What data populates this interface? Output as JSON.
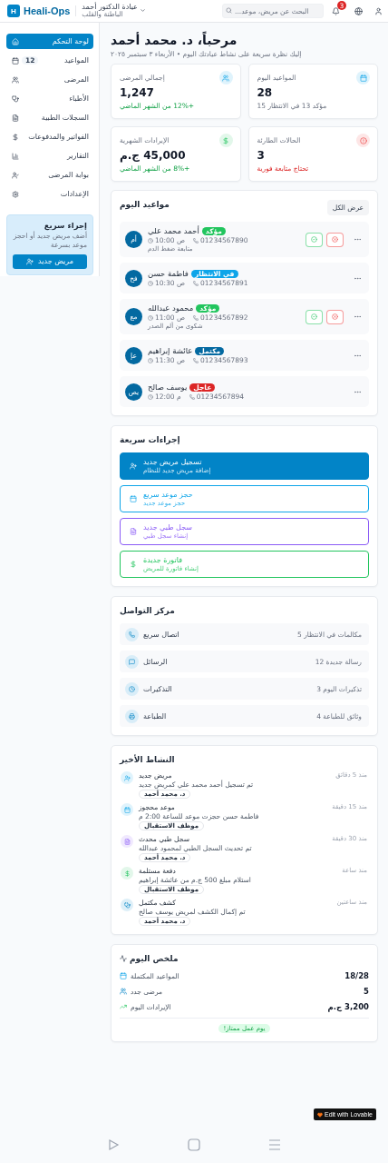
{
  "header": {
    "logo_letter": "H",
    "brand": "Heali-Ops",
    "clinic": {
      "name": "عيادة الدكتور أحمد",
      "specialty": "الباطنة والقلب"
    },
    "search": {
      "placeholder": "البحث عن مريض، موعد..."
    },
    "notifications": "3"
  },
  "sidebar": {
    "items": [
      {
        "label": "لوحة التحكم",
        "selected": true
      },
      {
        "label": "المواعيد",
        "badge": "12",
        "selected": false
      },
      {
        "label": "المرضى",
        "selected": false
      },
      {
        "label": "الأطباء",
        "selected": false
      },
      {
        "label": "السجلات الطبية",
        "selected": false
      },
      {
        "label": "الفواتير والمدفوعات",
        "selected": false
      },
      {
        "label": "التقارير",
        "selected": false
      },
      {
        "label": "بوابة المرضى",
        "selected": false
      },
      {
        "label": "الإعدادات",
        "selected": false
      }
    ],
    "quick_card": {
      "title": "إجراء سريع",
      "text": "أضف مريض جديد أو احجز موعد بسرعة",
      "button": "مريض جديد"
    }
  },
  "greeting": {
    "title": "مرحباً، د. محمد أحمد",
    "subtitle": "إليك نظرة سريعة على نشاط عيادتك اليوم • الأربعاء ٣ سبتمبر ٢٠٢٥"
  },
  "stats": [
    {
      "kind": "appointments",
      "label": "المواعيد اليوم",
      "value": "28",
      "note": "مؤكد 13 في الانتظار 15"
    },
    {
      "kind": "patients",
      "label": "إجمالي المرضى",
      "value": "1,247",
      "note": "+12% من الشهر الماضي"
    },
    {
      "kind": "emergency",
      "label": "الحالات الطارئة",
      "value": "3",
      "note": "تحتاج متابعة فورية"
    },
    {
      "kind": "revenue",
      "label": "الإيرادات الشهرية",
      "value": "45,000 ج.م",
      "note": "+8% من الشهر الماضي"
    }
  ],
  "appointments": {
    "title": "مواعيد اليوم",
    "view_all": "عرض الكل",
    "rows": [
      {
        "initials": "أم",
        "name": "أحمد محمد علي",
        "status": "مؤكد",
        "color": "#22c55e",
        "time": "10:00 ص",
        "phone": "01234567890",
        "note": "متابعة ضغط الدم",
        "actions": true
      },
      {
        "initials": "فح",
        "name": "فاطمة حسن",
        "status": "في الانتظار",
        "color": "#0ea5e9",
        "time": "10:30 ص",
        "phone": "01234567891",
        "actions": false
      },
      {
        "initials": "مع",
        "name": "محمود عبدالله",
        "status": "مؤكد",
        "color": "#22c55e",
        "time": "11:00 ص",
        "phone": "01234567892",
        "note": "شكوى من ألم الصدر",
        "actions": true
      },
      {
        "initials": "عإ",
        "name": "عائشة إبراهيم",
        "status": "مكتمل",
        "color": "#0369a1",
        "time": "11:30 ص",
        "phone": "01234567893",
        "actions": false
      },
      {
        "initials": "يص",
        "name": "يوسف صالح",
        "status": "عاجل",
        "color": "#dc2626",
        "time": "12:00 م",
        "phone": "01234567894",
        "actions": false
      }
    ]
  },
  "quick_actions": {
    "title": "إجراءات سريعة",
    "items": [
      {
        "kind": "primary",
        "title": "تسجيل مريض جديد",
        "subtitle": "إضافة مريض جديد للنظام",
        "color": "#0284c7"
      },
      {
        "kind": "outline",
        "title": "حجز موعد سريع",
        "subtitle": "حجز موعد جديد",
        "color": "#0ea5e9"
      },
      {
        "kind": "outline",
        "title": "سجل طبي جديد",
        "subtitle": "إنشاء سجل طبي",
        "color": "#8b5cf6"
      },
      {
        "kind": "outline",
        "title": "فاتورة جديدة",
        "subtitle": "إنشاء فاتورة للمريض",
        "color": "#22c55e"
      }
    ]
  },
  "communication": {
    "title": "مركز التواصل",
    "rows": [
      {
        "label": "اتصال سريع",
        "value": "مكالمات في الانتظار 5"
      },
      {
        "label": "الرسائل",
        "value": "رسالة جديدة 12"
      },
      {
        "label": "التذكيرات",
        "value": "تذكيرات اليوم 3"
      },
      {
        "label": "الطباعة",
        "value": "وثائق للطباعة 4"
      }
    ]
  },
  "activity": {
    "title": "النشاط الأخير",
    "items": [
      {
        "kind": "patient",
        "title": "مريض جديد",
        "text": "تم تسجيل أحمد محمد علي كمريض جديد",
        "user": "د. محمد أحمد",
        "time": "منذ 5 دقائق"
      },
      {
        "kind": "appointment",
        "title": "موعد محجوز",
        "text": "فاطمة حسن حجزت موعد للساعة 2:00 م",
        "user": "موظف الاستقبال",
        "time": "منذ 15 دقيقة"
      },
      {
        "kind": "record",
        "title": "سجل طبي محدث",
        "text": "تم تحديث السجل الطبي لمحمود عبدالله",
        "user": "د. محمد أحمد",
        "time": "منذ 30 دقيقة"
      },
      {
        "kind": "payment",
        "title": "دفعة مستلمة",
        "text": "استلام مبلغ 500 ج.م من عائشة إبراهيم",
        "user": "موظف الاستقبال",
        "time": "منذ ساعة"
      },
      {
        "kind": "exam",
        "title": "كشف مكتمل",
        "text": "تم إكمال الكشف لمريض يوسف صالح",
        "user": "د. محمد أحمد",
        "time": "منذ ساعتين"
      }
    ]
  },
  "summary": {
    "title": "ملخص اليوم",
    "rows": [
      {
        "label": "المواعيد المكتملة",
        "value": "18/28"
      },
      {
        "label": "مرضى جدد",
        "value": "5"
      },
      {
        "label": "الإيرادات اليوم",
        "value": "3,200 ج.م"
      }
    ],
    "badge": "يوم عمل ممتاز!"
  },
  "lovable_badge": "Edit with Lovable"
}
